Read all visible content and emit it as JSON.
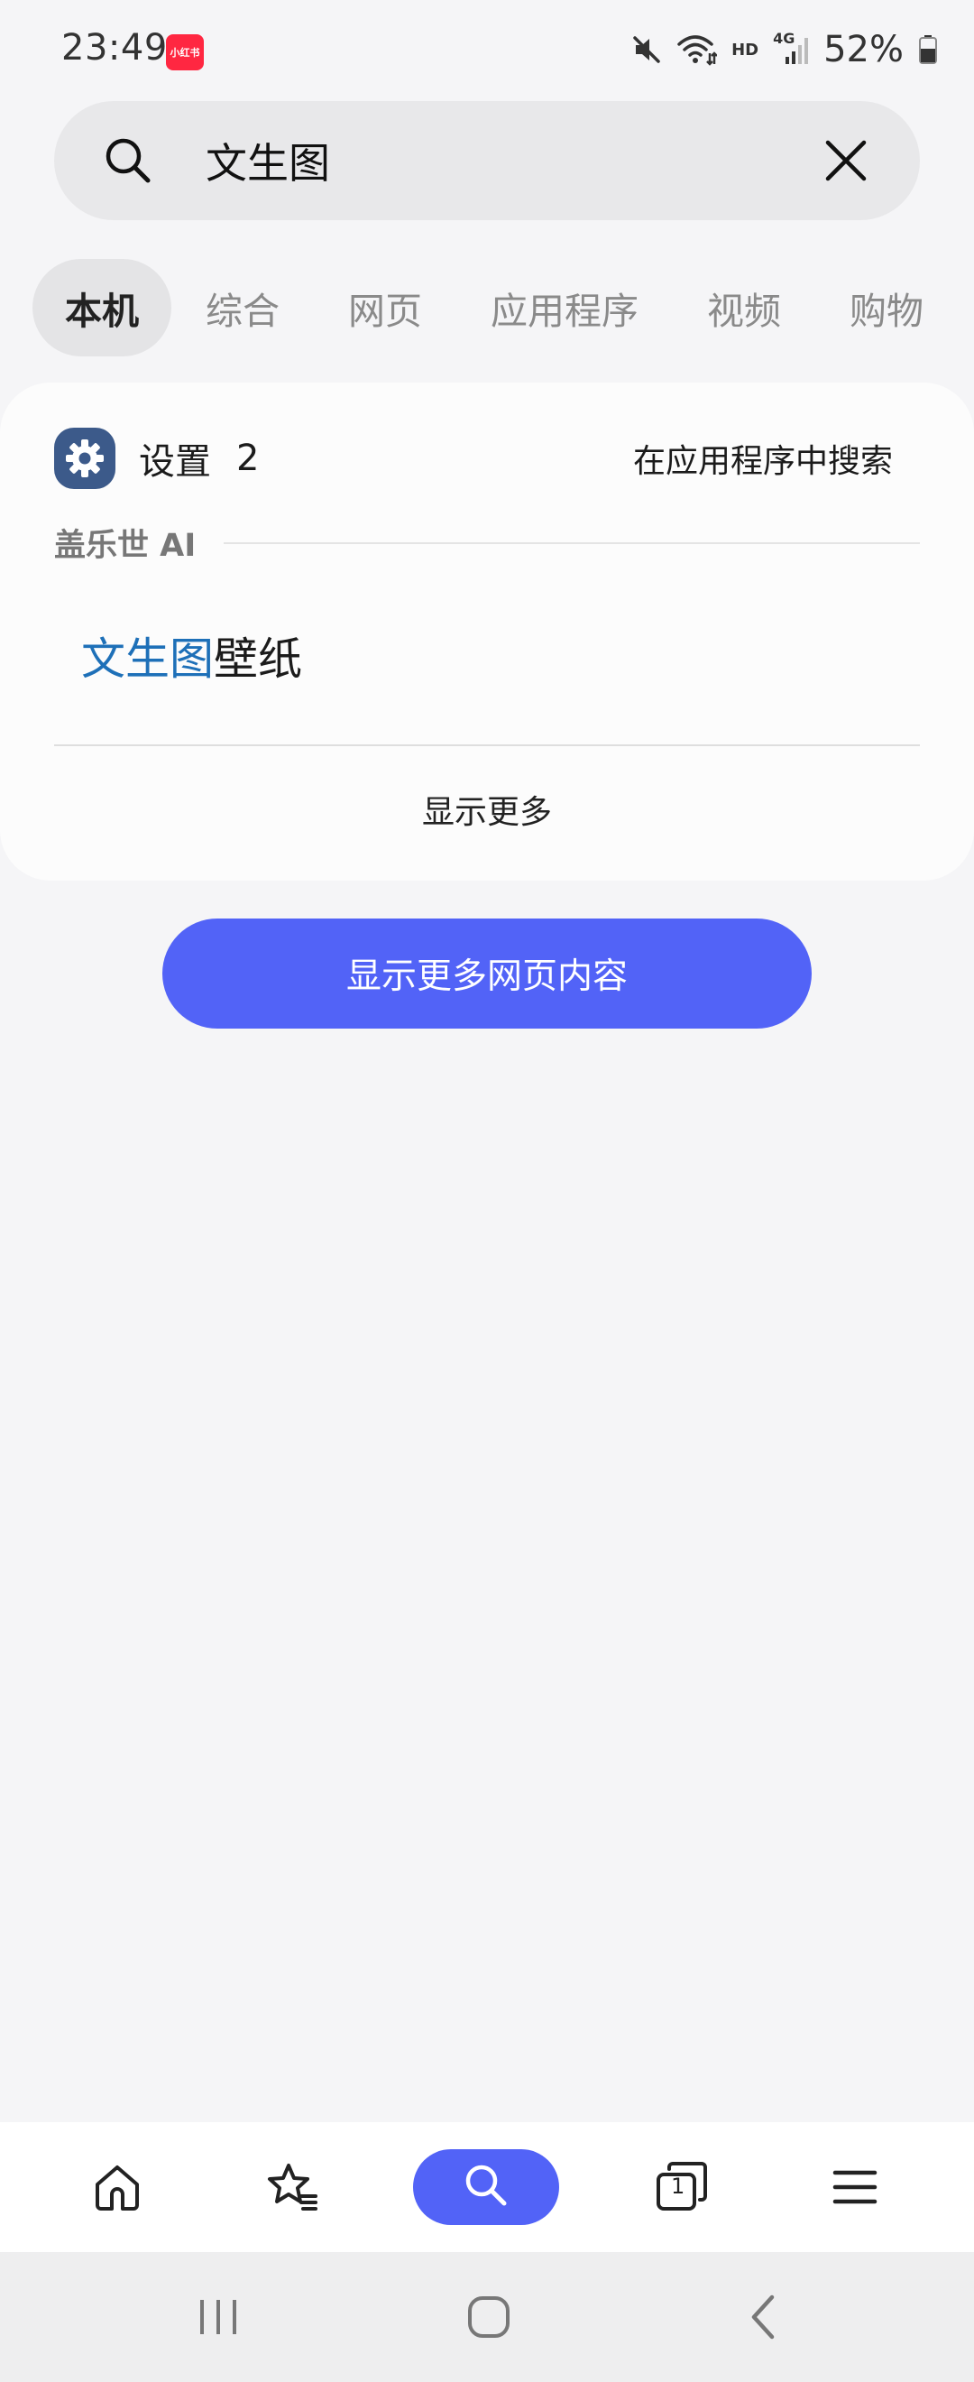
{
  "status_bar": {
    "time": "23:49",
    "app_badge": "小红书",
    "network_hd": "HD",
    "network_type": "4G",
    "battery_percent": "52%",
    "icons": [
      "mute-icon",
      "wifi-icon",
      "signal-icon",
      "battery-icon"
    ]
  },
  "search": {
    "query": "文生图",
    "icons": [
      "search-icon",
      "close-icon"
    ]
  },
  "tabs": [
    {
      "label": "本机",
      "active": true
    },
    {
      "label": "综合",
      "active": false
    },
    {
      "label": "网页",
      "active": false
    },
    {
      "label": "应用程序",
      "active": false
    },
    {
      "label": "视频",
      "active": false
    },
    {
      "label": "购物",
      "active": false
    }
  ],
  "results": {
    "app_name": "设置",
    "app_count": "2",
    "search_in_apps": "在应用程序中搜索",
    "section_label": "盖乐世 AI",
    "item_highlight": "文生图",
    "item_rest": "壁纸",
    "show_more": "显示更多"
  },
  "web_more_button": "显示更多网页内容",
  "bottom_toolbar": {
    "items": [
      "home-icon",
      "bookmarks-icon",
      "search-icon",
      "tabs-icon",
      "menu-icon"
    ],
    "tabs_count": "1",
    "accent_color": "#5263f7"
  },
  "nav_bar": {
    "items": [
      "recent-apps-icon",
      "home-icon",
      "back-icon"
    ]
  }
}
